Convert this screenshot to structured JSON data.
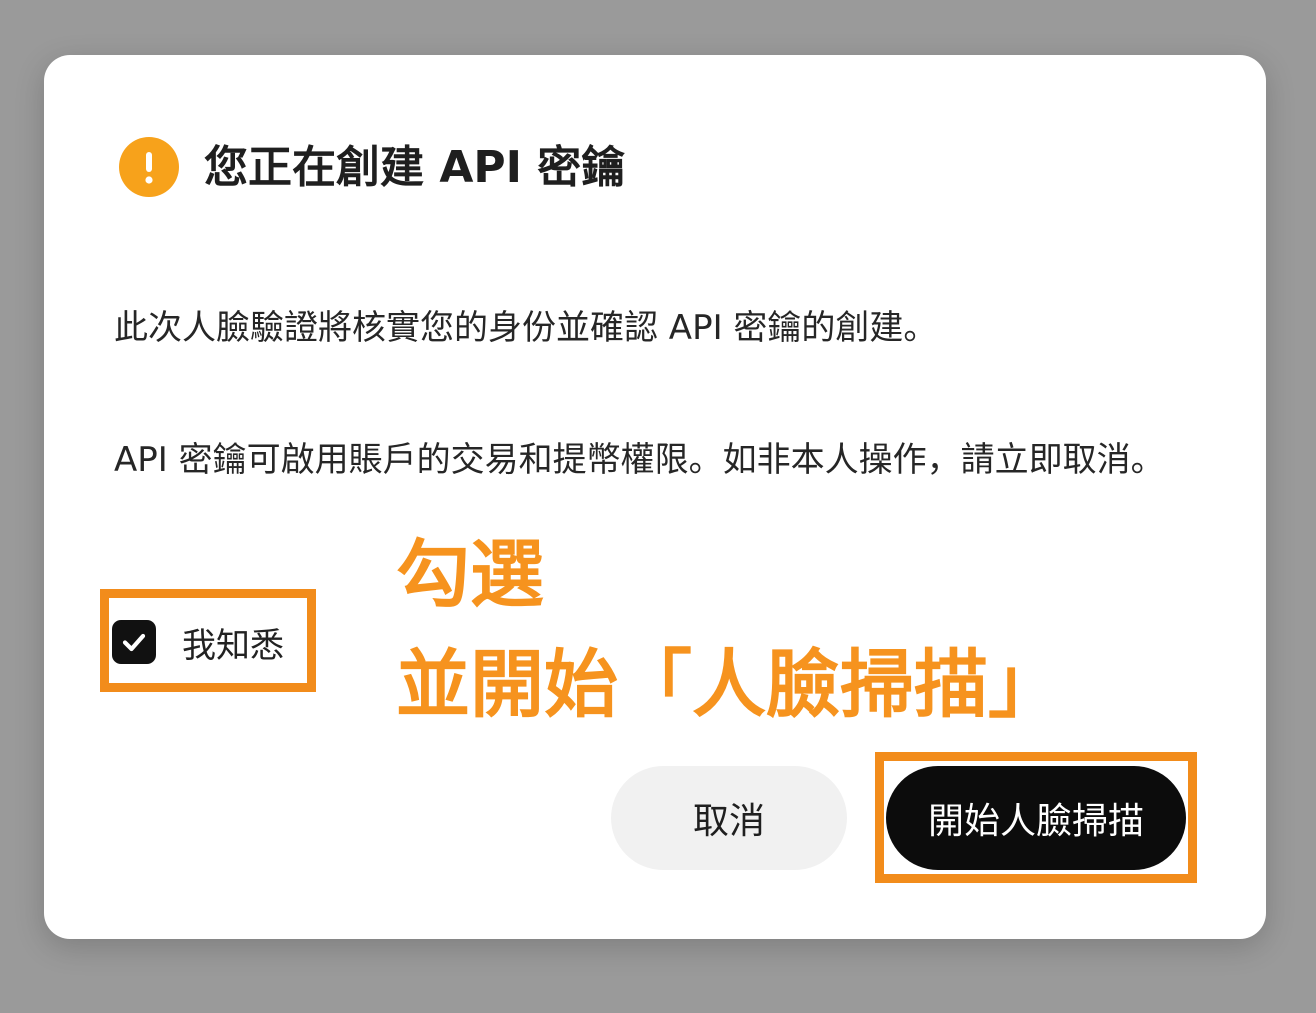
{
  "dialog": {
    "title": "您正在創建 API 密鑰",
    "warning_icon": "exclamation-circle-icon",
    "paragraph1": "此次人臉驗證將核實您的身份並確認 API 密鑰的創建。",
    "paragraph2": "API 密鑰可啟用賬戶的交易和提幣權限。如非本人操作，請立即取消。",
    "acknowledge": {
      "label": "我知悉",
      "checked": true
    },
    "buttons": {
      "cancel": "取消",
      "start": "開始人臉掃描"
    }
  },
  "annotation": {
    "line1": "勾選",
    "line2": "並開始「人臉掃描」",
    "color": "#f6931e"
  },
  "colors": {
    "warning": "#f7a21b",
    "highlight": "#f28c1b",
    "primary_button": "#0c0c0c",
    "overlay": "#9a9a9a"
  }
}
